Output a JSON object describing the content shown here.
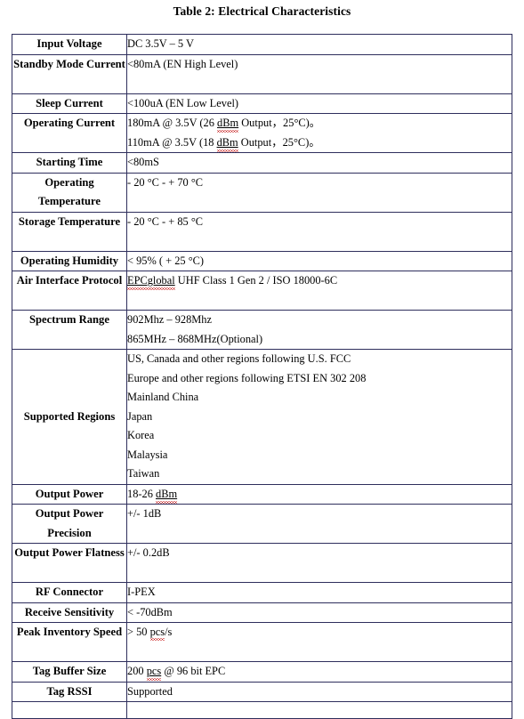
{
  "document": {
    "title": "Table 2: Electrical Characteristics"
  },
  "table": {
    "border_color": "#2e2e5c",
    "rows": [
      {
        "label": "Input Voltage",
        "label_align": "middle",
        "lines": [
          [
            {
              "t": "DC 3.5V – 5 V"
            }
          ]
        ]
      },
      {
        "label": "Standby Mode Current",
        "label_align": "top",
        "lines": [
          [
            {
              "t": "<80mA (EN High Level)"
            }
          ],
          [
            {
              "t": ""
            }
          ]
        ]
      },
      {
        "label": "Sleep Current",
        "label_align": "middle",
        "lines": [
          [
            {
              "t": "<100uA (EN Low Level)"
            }
          ]
        ]
      },
      {
        "label": "Operating Current",
        "label_align": "top",
        "lines": [
          [
            {
              "t": "180mA @ 3.5V (26 "
            },
            {
              "t": "dBm",
              "mark": "spell-underline"
            },
            {
              "t": " Output，25°C)。"
            }
          ],
          [
            {
              "t": "110mA @ 3.5V (18 "
            },
            {
              "t": "dBm",
              "mark": "spell-underline"
            },
            {
              "t": " Output，25°C)。"
            }
          ]
        ]
      },
      {
        "label": "Starting Time",
        "label_align": "middle",
        "lines": [
          [
            {
              "t": "<80mS"
            }
          ]
        ]
      },
      {
        "label": "Operating Temperature",
        "label_align": "top",
        "lines": [
          [
            {
              "t": "- 20 °C  -  + 70   °C"
            }
          ],
          [
            {
              "t": ""
            }
          ]
        ]
      },
      {
        "label": "Storage Temperature",
        "label_align": "top",
        "lines": [
          [
            {
              "t": "- 20 °C  -  + 85   °C"
            }
          ],
          [
            {
              "t": ""
            }
          ]
        ]
      },
      {
        "label": "Operating Humidity",
        "label_align": "middle",
        "lines": [
          [
            {
              "t": "< 95% ( + 25 °C)"
            }
          ]
        ]
      },
      {
        "label": "Air Interface Protocol",
        "label_align": "top",
        "lines": [
          [
            {
              "t": "EPCglobal",
              "mark": "spell-underline"
            },
            {
              "t": " UHF Class 1 Gen 2 / ISO 18000-6C"
            }
          ],
          [
            {
              "t": ""
            }
          ]
        ]
      },
      {
        "label": "Spectrum Range",
        "label_align": "top",
        "lines": [
          [
            {
              "t": "902Mhz – 928Mhz"
            }
          ],
          [
            {
              "t": "865MHz – 868MHz(Optional)"
            }
          ]
        ]
      },
      {
        "label": "Supported Regions",
        "label_align": "middle",
        "lines": [
          [
            {
              "t": "US, Canada and other regions following U.S. FCC"
            }
          ],
          [
            {
              "t": "Europe and other regions following ETSI EN 302 208"
            }
          ],
          [
            {
              "t": "Mainland China"
            }
          ],
          [
            {
              "t": "Japan"
            }
          ],
          [
            {
              "t": "Korea"
            }
          ],
          [
            {
              "t": "Malaysia"
            }
          ],
          [
            {
              "t": "Taiwan"
            }
          ]
        ]
      },
      {
        "label": "Output Power",
        "label_align": "middle",
        "lines": [
          [
            {
              "t": "18-26 "
            },
            {
              "t": "dBm",
              "mark": "spell-underline"
            }
          ]
        ]
      },
      {
        "label": "Output Power Precision",
        "label_align": "top",
        "lines": [
          [
            {
              "t": "+/- 1dB"
            }
          ],
          [
            {
              "t": ""
            }
          ]
        ]
      },
      {
        "label": "Output Power Flatness",
        "label_align": "top",
        "lines": [
          [
            {
              "t": "+/- 0.2dB"
            }
          ],
          [
            {
              "t": ""
            }
          ]
        ]
      },
      {
        "label": "RF Connector",
        "label_align": "middle",
        "lines": [
          [
            {
              "t": "I-PEX"
            }
          ]
        ]
      },
      {
        "label": "Receive Sensitivity",
        "label_align": "middle",
        "lines": [
          [
            {
              "t": "< -70dBm"
            }
          ]
        ]
      },
      {
        "label": "Peak Inventory Speed",
        "label_align": "top",
        "lines": [
          [
            {
              "t": "> 50 "
            },
            {
              "t": "pcs",
              "mark": "spell"
            },
            {
              "t": "/s"
            }
          ],
          [
            {
              "t": ""
            }
          ]
        ]
      },
      {
        "label": "Tag Buffer Size",
        "label_align": "middle",
        "lines": [
          [
            {
              "t": "200 "
            },
            {
              "t": "pcs",
              "mark": "spell-underline"
            },
            {
              "t": " @ 96 bit EPC"
            }
          ]
        ]
      },
      {
        "label": "Tag RSSI",
        "label_align": "middle",
        "lines": [
          [
            {
              "t": "Supported"
            }
          ]
        ]
      }
    ]
  }
}
